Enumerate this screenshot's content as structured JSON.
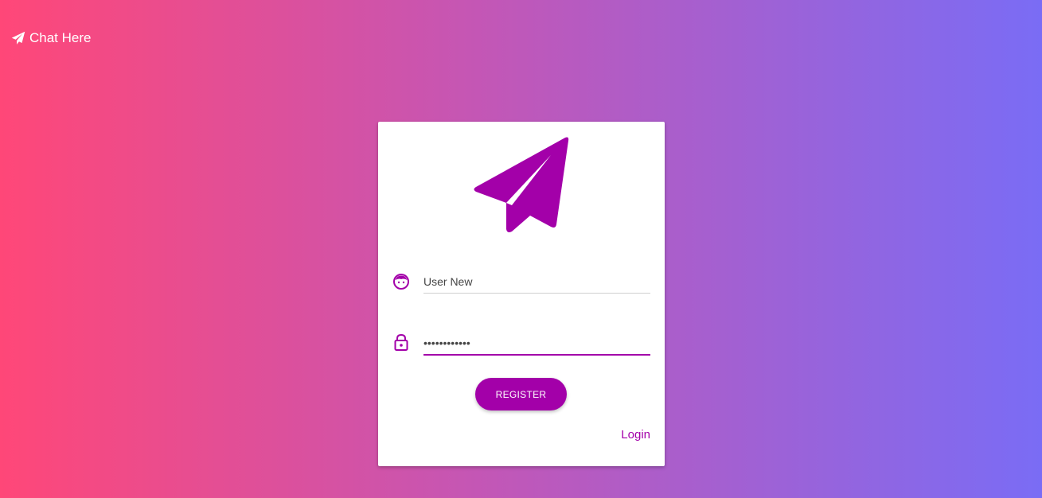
{
  "brand": {
    "icon": "paper-plane-icon",
    "title": "Chat Here"
  },
  "theme": {
    "accent": "#a300a9",
    "gradient_left": "#ff4778",
    "gradient_right": "#7a6cf5"
  },
  "card": {
    "logo_icon": "paper-plane-icon",
    "username": {
      "icon": "face-icon",
      "value": "User New"
    },
    "password": {
      "icon": "lock-icon",
      "value": "••••••••••••"
    },
    "register_label": "REGISTER",
    "login_label": "Login"
  }
}
